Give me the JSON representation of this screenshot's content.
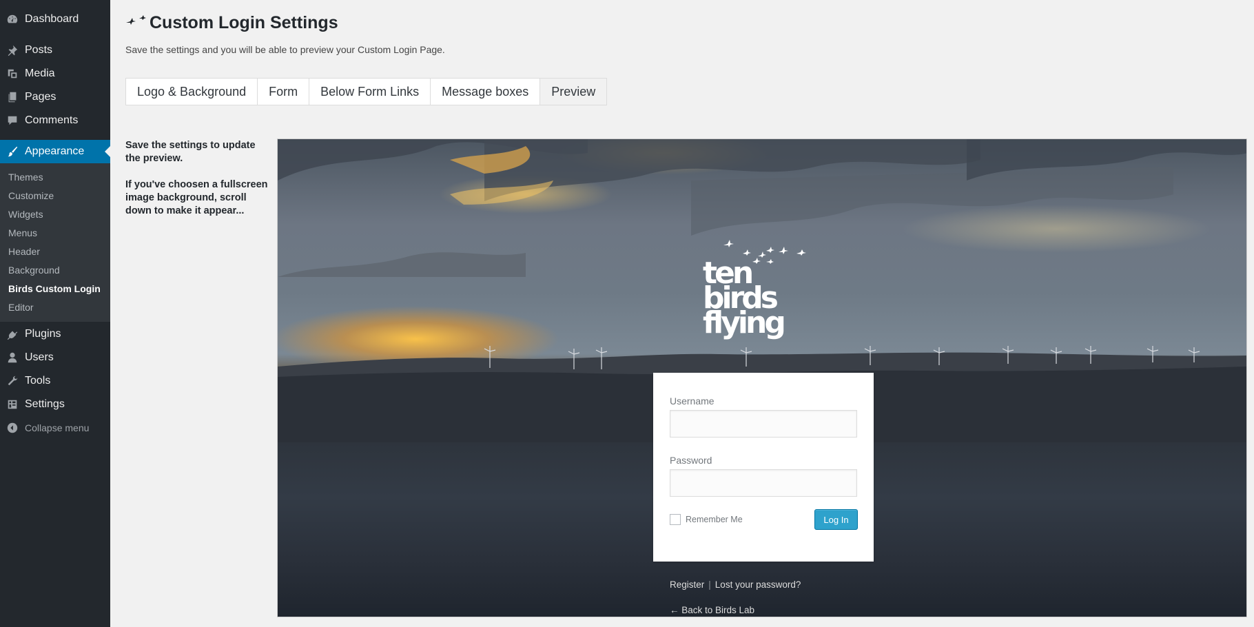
{
  "sidebar": {
    "items": [
      {
        "label": "Dashboard",
        "icon": "dashboard-icon"
      },
      {
        "label": "Posts",
        "icon": "pin-icon"
      },
      {
        "label": "Media",
        "icon": "media-icon"
      },
      {
        "label": "Pages",
        "icon": "pages-icon"
      },
      {
        "label": "Comments",
        "icon": "comments-icon"
      },
      {
        "label": "Appearance",
        "icon": "paintbrush-icon",
        "active": true
      },
      {
        "label": "Plugins",
        "icon": "plugin-icon"
      },
      {
        "label": "Users",
        "icon": "user-icon"
      },
      {
        "label": "Tools",
        "icon": "wrench-icon"
      },
      {
        "label": "Settings",
        "icon": "settings-icon"
      }
    ],
    "submenu": [
      "Themes",
      "Customize",
      "Widgets",
      "Menus",
      "Header",
      "Background",
      "Birds Custom Login",
      "Editor"
    ],
    "submenu_current": "Birds Custom Login",
    "collapse_label": "Collapse menu"
  },
  "header": {
    "title": "Custom Login Settings",
    "intro": "Save the settings and you will be able to preview your Custom Login Page."
  },
  "tabs": [
    {
      "label": "Logo & Background"
    },
    {
      "label": "Form"
    },
    {
      "label": "Below Form Links"
    },
    {
      "label": "Message boxes"
    },
    {
      "label": "Preview",
      "active": true
    }
  ],
  "note": {
    "p1": "Save the settings to update the preview.",
    "p2": "If you've choosen a fullscreen image background, scroll down to make it appear..."
  },
  "preview": {
    "logo_lines": [
      "ten",
      "birds",
      "flying"
    ],
    "username_label": "Username",
    "username_value": "",
    "password_label": "Password",
    "password_value": "",
    "remember_label": "Remember Me",
    "login_button": "Log In",
    "register_link": "Register",
    "separator": "|",
    "lost_password_link": "Lost your password?",
    "back_link": "← Back to Birds Lab"
  },
  "colors": {
    "sidebar_bg": "#23282d",
    "submenu_bg": "#32373c",
    "accent": "#0073aa",
    "button": "#2ea2cc"
  }
}
